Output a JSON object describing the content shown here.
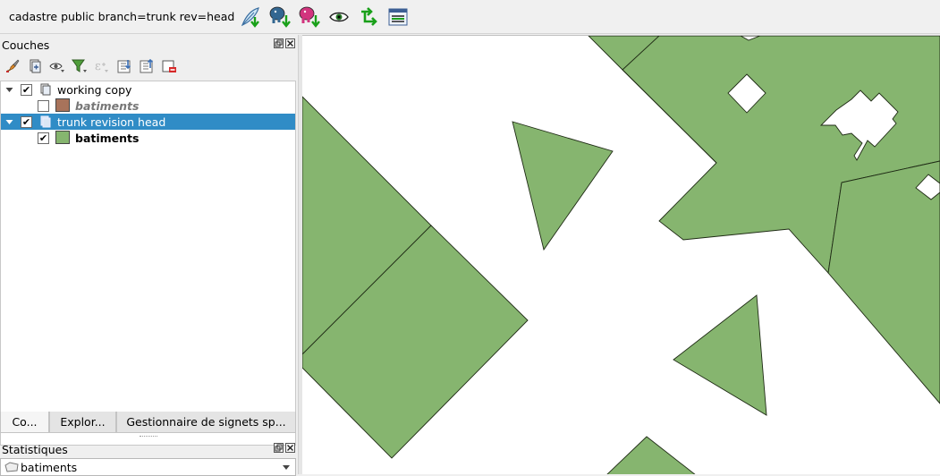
{
  "toolbar": {
    "title": "cadastre public branch=trunk rev=head",
    "buttons": [
      {
        "name": "commit-button",
        "icon": "feather-pen-icon"
      },
      {
        "name": "upload-blue-db-button",
        "icon": "postgres-elephant-blue-icon"
      },
      {
        "name": "upload-pink-db-button",
        "icon": "postgres-elephant-pink-icon"
      },
      {
        "name": "view-button",
        "icon": "eye-icon"
      },
      {
        "name": "branch-button",
        "icon": "branch-arrow-icon"
      },
      {
        "name": "list-button",
        "icon": "list-icon"
      }
    ]
  },
  "layers_panel": {
    "title": "Couches",
    "tools": [
      "paint-brush-icon",
      "add-group-icon",
      "eye-menu-icon",
      "filter-icon",
      "expression-filter-icon",
      "expand-all-icon",
      "collapse-all-icon",
      "remove-layer-icon"
    ],
    "tree": [
      {
        "label": "working copy",
        "checked": true,
        "type": "group",
        "selected": false
      },
      {
        "label": "batiments",
        "checked": false,
        "type": "layer",
        "color": "#a8735b",
        "style": "italic-gray"
      },
      {
        "label": "trunk revision head",
        "checked": true,
        "type": "group",
        "selected": true
      },
      {
        "label": "batiments",
        "checked": true,
        "type": "layer",
        "color": "#86b56f",
        "style": "bold"
      }
    ]
  },
  "tabs": [
    {
      "label": "Co...",
      "active": true
    },
    {
      "label": "Explor...",
      "active": false
    },
    {
      "label": "Gestionnaire de signets sp...",
      "active": false
    }
  ],
  "stats_panel": {
    "title": "Statistiques",
    "layer_value": "batiments"
  },
  "map": {
    "fill_color": "#86b56f",
    "stroke_color": "#1e2a14"
  }
}
